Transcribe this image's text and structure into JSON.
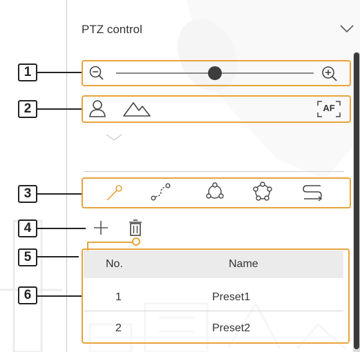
{
  "panel": {
    "title": "PTZ control",
    "collapse_icon": "chevron-down-icon"
  },
  "callouts": [
    "1",
    "2",
    "3",
    "4",
    "5",
    "6"
  ],
  "zoom": {
    "out_icon": "zoom-out-icon",
    "in_icon": "zoom-in-icon",
    "level": 0.5
  },
  "focus_row": {
    "icons": [
      "person-icon",
      "mountain-icon",
      "autofocus-icon"
    ],
    "af_label": "AF"
  },
  "ptz_modes": {
    "icons": [
      "preset-icon",
      "swing-icon",
      "group-icon",
      "tour-icon",
      "trace-icon"
    ]
  },
  "preset_actions": {
    "add_icon": "plus-icon",
    "delete_icon": "trash-icon"
  },
  "preset_table": {
    "headers": [
      "No.",
      "Name"
    ],
    "rows": [
      {
        "no": "1",
        "name": "Preset1"
      },
      {
        "no": "2",
        "name": "Preset2"
      }
    ]
  },
  "colors": {
    "highlight": "#e8a33a",
    "scroll_thumb": "#3a3a3a",
    "table_header": "#ebebeb"
  }
}
